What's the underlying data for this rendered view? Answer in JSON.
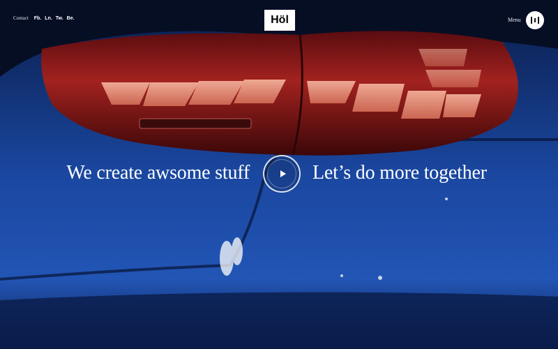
{
  "header": {
    "contact_label": "Contact",
    "social_links": [
      "Fb.",
      "Ln.",
      "Tw.",
      "Be."
    ],
    "logo_text": "Höl",
    "menu_label": "Menu"
  },
  "hero": {
    "left_headline": "We create awsome stuff",
    "right_headline": "Let’s do more together"
  },
  "colors": {
    "taillight_red": "#8e1a18",
    "light_segments": "#e79075",
    "car_blue": "#1c4ea8",
    "text": "#ffffff"
  }
}
